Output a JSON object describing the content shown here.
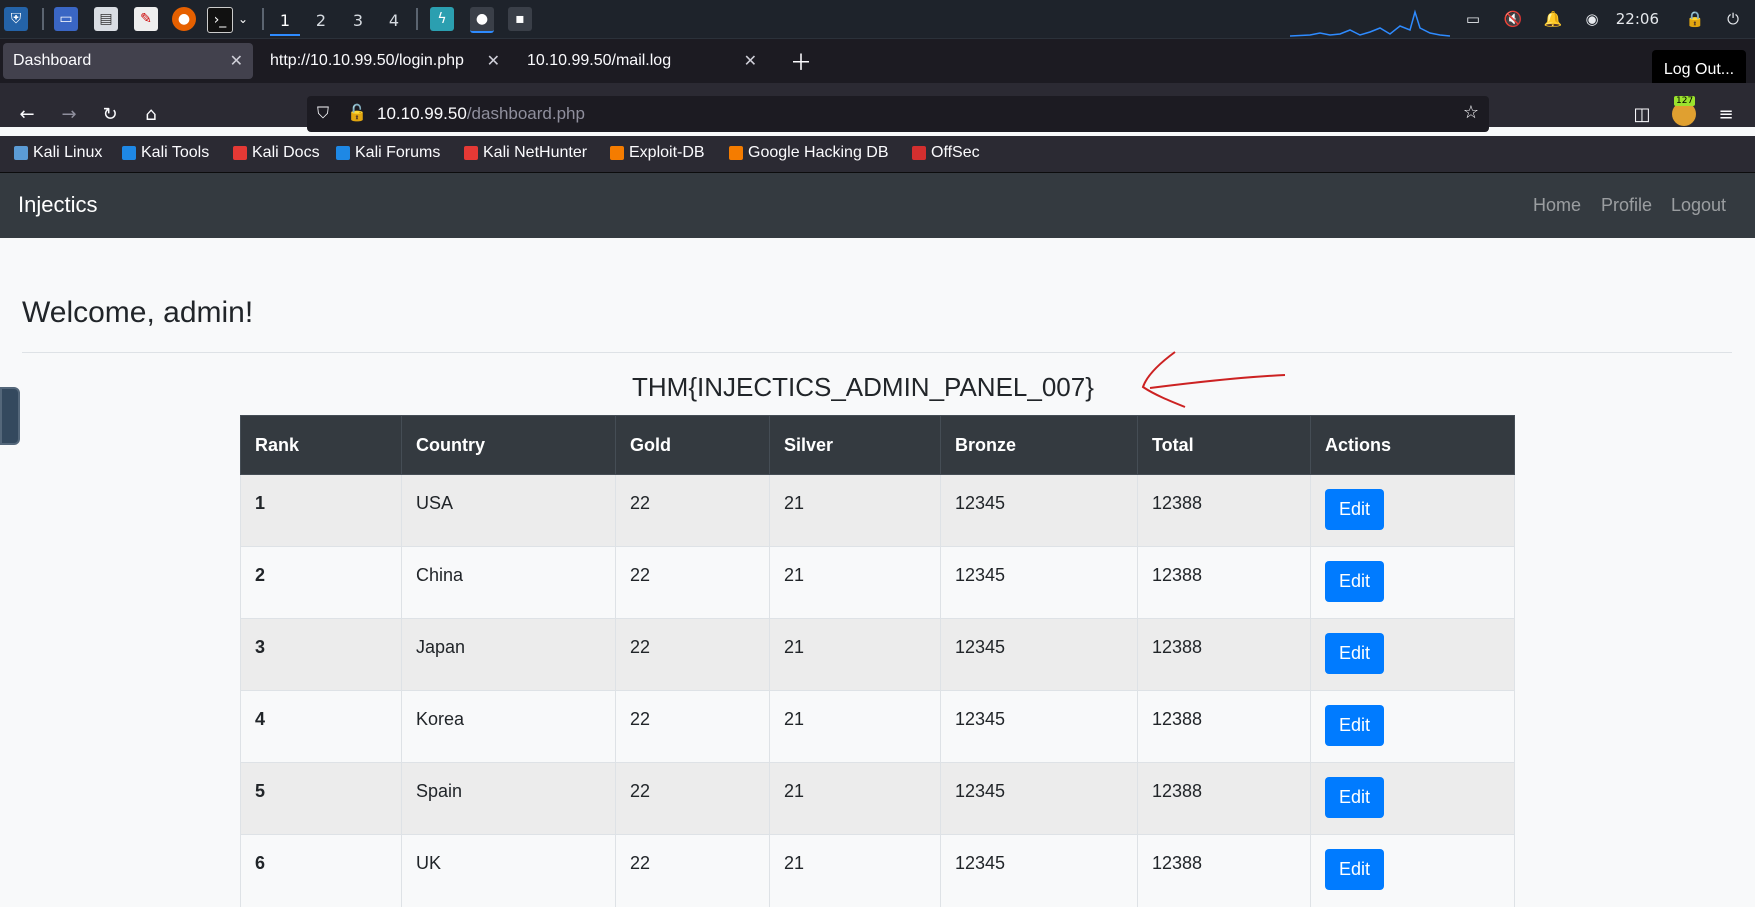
{
  "taskbar": {
    "workspaces": [
      "1",
      "2",
      "3",
      "4"
    ],
    "clock": "22:06",
    "icons": [
      "kali-menu-icon",
      "desktop-icon",
      "file-manager-icon",
      "text-editor-icon",
      "firefox-icon",
      "terminal-icon",
      "chevron-down-icon",
      "burpsuite-icon",
      "firefox-running-icon",
      "terminal-running-icon"
    ]
  },
  "browser": {
    "tabs": [
      {
        "label": "Dashboard",
        "active": true
      },
      {
        "label": "http://10.10.99.50/login.php",
        "active": false
      },
      {
        "label": "10.10.99.50/mail.log",
        "active": false
      }
    ],
    "tooltip": "Log Out...",
    "url_host": "10.10.99.50",
    "url_path": "/dashboard.php",
    "extension_badge": "127",
    "bookmarks": [
      {
        "label": "Kali Linux",
        "color": "#5b9bd5"
      },
      {
        "label": "Kali Tools",
        "color": "#1e88e5"
      },
      {
        "label": "Kali Docs",
        "color": "#e53935"
      },
      {
        "label": "Kali Forums",
        "color": "#1e88e5"
      },
      {
        "label": "Kali NetHunter",
        "color": "#e53935"
      },
      {
        "label": "Exploit-DB",
        "color": "#f57c00"
      },
      {
        "label": "Google Hacking DB",
        "color": "#f57c00"
      },
      {
        "label": "OffSec",
        "color": "#d32f2f"
      }
    ]
  },
  "site": {
    "brand": "Injectics",
    "nav": [
      "Home",
      "Profile",
      "Logout"
    ],
    "welcome": "Welcome, admin!",
    "flag": "THM{INJECTICS_ADMIN_PANEL_007}",
    "table": {
      "headers": [
        "Rank",
        "Country",
        "Gold",
        "Silver",
        "Bronze",
        "Total",
        "Actions"
      ],
      "rows": [
        [
          "1",
          "USA",
          "22",
          "21",
          "12345",
          "12388"
        ],
        [
          "2",
          "China",
          "22",
          "21",
          "12345",
          "12388"
        ],
        [
          "3",
          "Japan",
          "22",
          "21",
          "12345",
          "12388"
        ],
        [
          "4",
          "Korea",
          "22",
          "21",
          "12345",
          "12388"
        ],
        [
          "5",
          "Spain",
          "22",
          "21",
          "12345",
          "12388"
        ],
        [
          "6",
          "UK",
          "22",
          "21",
          "12345",
          "12388"
        ]
      ],
      "action_label": "Edit"
    }
  },
  "colors": {
    "navbar": "#343a40",
    "edit_button": "#007bff",
    "annotation_arrow": "#cc2222"
  }
}
